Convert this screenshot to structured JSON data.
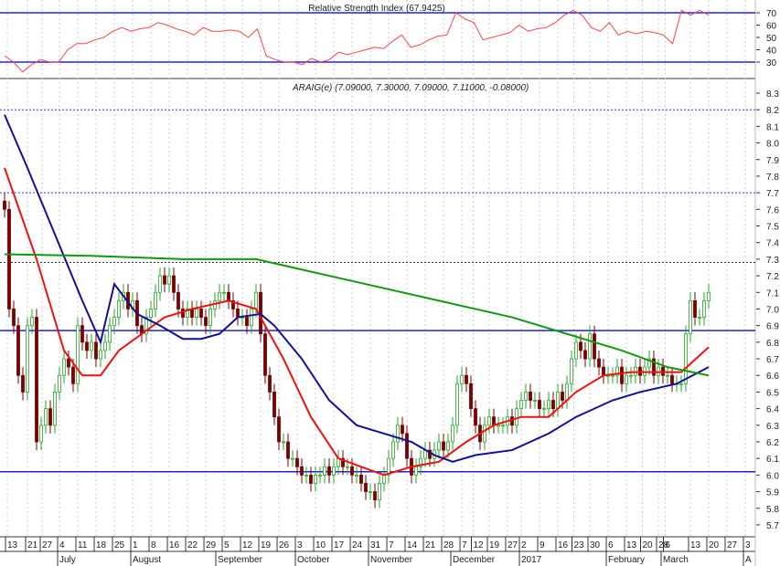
{
  "chart_data": {
    "type": "candlestick",
    "rsi": {
      "title": "Relative Strength Index (67.9425)",
      "levels": [
        70,
        30
      ],
      "ticks": [
        70,
        60,
        50,
        40,
        30
      ],
      "range": [
        20,
        80
      ],
      "values": [
        35,
        30,
        22,
        28,
        32,
        30,
        30,
        40,
        45,
        45,
        48,
        50,
        55,
        58,
        55,
        57,
        58,
        62,
        60,
        57,
        55,
        52,
        58,
        55,
        55,
        56,
        55,
        50,
        57,
        35,
        32,
        30,
        30,
        28,
        33,
        30,
        32,
        38,
        36,
        38,
        40,
        42,
        41,
        47,
        52,
        42,
        44,
        48,
        51,
        52,
        70,
        65,
        62,
        48,
        50,
        52,
        54,
        60,
        55,
        57,
        58,
        62,
        68,
        72,
        68,
        58,
        55,
        62,
        52,
        55,
        53,
        55,
        54,
        52,
        45,
        72,
        68,
        72,
        68
      ]
    },
    "price": {
      "title": "ARAIG(e) (7.09000, 7.30000, 7.09000, 7.11000, -0.08000)",
      "ylim": [
        5.65,
        8.35
      ],
      "ticks": [
        "8.3",
        "8.2",
        "8.1",
        "8.0",
        "7.9",
        "7.8",
        "7.7",
        "7.6",
        "7.5",
        "7.4",
        "7.3",
        "7.2",
        "7.1",
        "7.0",
        "6.9",
        "6.8",
        "6.7",
        "6.6",
        "6.5",
        "6.4",
        "6.3",
        "6.2",
        "6.1",
        "6.0",
        "5.9",
        "5.8",
        "5.7"
      ],
      "closes": [
        7.6,
        7.0,
        6.9,
        6.6,
        6.5,
        6.9,
        6.95,
        6.2,
        6.3,
        6.4,
        6.3,
        6.5,
        6.6,
        6.7,
        6.65,
        6.55,
        6.9,
        6.8,
        6.75,
        6.8,
        6.7,
        6.75,
        6.8,
        6.9,
        6.95,
        7.05,
        7.1,
        7.0,
        7.05,
        6.9,
        6.85,
        6.95,
        7.0,
        7.1,
        7.2,
        7.15,
        7.2,
        7.1,
        7.0,
        6.95,
        7.0,
        6.95,
        7.0,
        6.95,
        6.9,
        7.0,
        7.05,
        7.1,
        7.1,
        7.05,
        7.0,
        6.95,
        6.95,
        6.9,
        7.0,
        7.1,
        6.85,
        6.6,
        6.5,
        6.35,
        6.2,
        6.2,
        6.1,
        6.1,
        6.05,
        6.0,
        6.0,
        5.95,
        6.0,
        6.0,
        6.05,
        6.0,
        6.05,
        6.1,
        6.05,
        6.05,
        6.0,
        6.0,
        5.95,
        5.9,
        5.9,
        5.85,
        5.95,
        6.0,
        6.1,
        6.2,
        6.3,
        6.25,
        6.1,
        6.0,
        6.05,
        6.1,
        6.15,
        6.1,
        6.15,
        6.2,
        6.15,
        6.2,
        6.3,
        6.55,
        6.6,
        6.55,
        6.4,
        6.3,
        6.2,
        6.3,
        6.35,
        6.3,
        6.3,
        6.3,
        6.35,
        6.3,
        6.4,
        6.45,
        6.5,
        6.45,
        6.45,
        6.4,
        6.4,
        6.45,
        6.4,
        6.5,
        6.45,
        6.55,
        6.7,
        6.8,
        6.75,
        6.7,
        6.85,
        6.7,
        6.65,
        6.6,
        6.6,
        6.6,
        6.65,
        6.55,
        6.6,
        6.6,
        6.65,
        6.6,
        6.65,
        6.7,
        6.6,
        6.65,
        6.6,
        6.6,
        6.55,
        6.55,
        6.55,
        6.85,
        7.05,
        6.95,
        6.95,
        7.05,
        7.1
      ],
      "moving_averages": [
        {
          "name": "short",
          "color": "#ee1111",
          "points": [
            [
              0,
              7.85
            ],
            [
              7,
              7.3
            ],
            [
              13,
              6.75
            ],
            [
              17,
              6.6
            ],
            [
              21,
              6.6
            ],
            [
              25,
              6.75
            ],
            [
              30,
              6.85
            ],
            [
              35,
              6.95
            ],
            [
              41,
              7.0
            ],
            [
              49,
              7.05
            ],
            [
              55,
              7.0
            ],
            [
              61,
              6.7
            ],
            [
              67,
              6.35
            ],
            [
              73,
              6.1
            ],
            [
              78,
              6.05
            ],
            [
              83,
              6.0
            ],
            [
              89,
              6.05
            ],
            [
              95,
              6.08
            ],
            [
              101,
              6.2
            ],
            [
              107,
              6.3
            ],
            [
              113,
              6.35
            ],
            [
              119,
              6.35
            ],
            [
              125,
              6.5
            ],
            [
              131,
              6.6
            ],
            [
              137,
              6.62
            ],
            [
              143,
              6.62
            ],
            [
              148,
              6.62
            ],
            [
              154,
              6.77
            ]
          ]
        },
        {
          "name": "medium",
          "color": "#11118f",
          "points": [
            [
              0,
              8.17
            ],
            [
              5,
              7.85
            ],
            [
              11,
              7.45
            ],
            [
              17,
              7.05
            ],
            [
              21,
              6.8
            ],
            [
              24,
              7.15
            ],
            [
              29,
              6.97
            ],
            [
              34,
              6.9
            ],
            [
              39,
              6.82
            ],
            [
              43,
              6.82
            ],
            [
              47,
              6.85
            ],
            [
              51,
              6.95
            ],
            [
              56,
              6.97
            ],
            [
              59,
              6.9
            ],
            [
              65,
              6.7
            ],
            [
              71,
              6.45
            ],
            [
              77,
              6.3
            ],
            [
              83,
              6.25
            ],
            [
              89,
              6.2
            ],
            [
              94,
              6.12
            ],
            [
              98,
              6.08
            ],
            [
              103,
              6.12
            ],
            [
              111,
              6.15
            ],
            [
              119,
              6.25
            ],
            [
              125,
              6.35
            ],
            [
              133,
              6.45
            ],
            [
              139,
              6.5
            ],
            [
              147,
              6.55
            ],
            [
              154,
              6.65
            ]
          ]
        },
        {
          "name": "long",
          "color": "#119911",
          "points": [
            [
              0,
              7.33
            ],
            [
              19,
              7.32
            ],
            [
              39,
              7.3
            ],
            [
              55,
              7.3
            ],
            [
              63,
              7.25
            ],
            [
              79,
              7.15
            ],
            [
              95,
              7.05
            ],
            [
              111,
              6.95
            ],
            [
              123,
              6.85
            ],
            [
              135,
              6.75
            ],
            [
              145,
              6.65
            ],
            [
              154,
              6.6
            ]
          ]
        }
      ],
      "levels": [
        {
          "value": 6.87,
          "style": "solid"
        },
        {
          "value": 6.02,
          "style": "solid"
        },
        {
          "value": 8.2,
          "style": "dotted"
        },
        {
          "value": 7.7,
          "style": "dotted"
        },
        {
          "value": 7.28,
          "style": "dotted-dark"
        }
      ]
    },
    "x_ticks": [
      [
        "13",
        0.6
      ],
      [
        "21",
        5
      ],
      [
        "27",
        8.2
      ],
      [
        "4",
        12
      ],
      [
        "11",
        16
      ],
      [
        "18",
        20
      ],
      [
        "25",
        24
      ],
      [
        "1",
        28
      ],
      [
        "8",
        32
      ],
      [
        "16",
        36
      ],
      [
        "22",
        40
      ],
      [
        "29",
        44
      ],
      [
        "5",
        48
      ],
      [
        "12",
        52
      ],
      [
        "19",
        56
      ],
      [
        "26",
        60
      ],
      [
        "3",
        64
      ],
      [
        "10",
        68
      ],
      [
        "17",
        72
      ],
      [
        "24",
        76
      ],
      [
        "31",
        80
      ],
      [
        "7",
        84
      ],
      [
        "14",
        88
      ],
      [
        "21",
        92
      ],
      [
        "28",
        96
      ],
      [
        "7",
        100
      ],
      [
        "12",
        102.5
      ],
      [
        "19",
        106
      ],
      [
        "27",
        110
      ],
      [
        "2",
        113
      ],
      [
        "9",
        117
      ],
      [
        "16",
        121
      ],
      [
        "23",
        124.5
      ],
      [
        "30",
        128
      ],
      [
        "6",
        132
      ],
      [
        "13",
        136
      ],
      [
        "20",
        139.5
      ],
      [
        "28",
        143
      ],
      [
        "6",
        144.5
      ],
      [
        "13",
        150
      ],
      [
        "20",
        154
      ],
      [
        "27",
        158
      ],
      [
        "3",
        162
      ]
    ],
    "x_months": [
      [
        "July",
        12
      ],
      [
        "August",
        28
      ],
      [
        "September",
        46.6
      ],
      [
        "October",
        64
      ],
      [
        "November",
        80
      ],
      [
        "December",
        98
      ],
      [
        "2017",
        113
      ],
      [
        "February",
        132
      ],
      [
        "March",
        144
      ],
      [
        "A",
        162
      ]
    ]
  }
}
